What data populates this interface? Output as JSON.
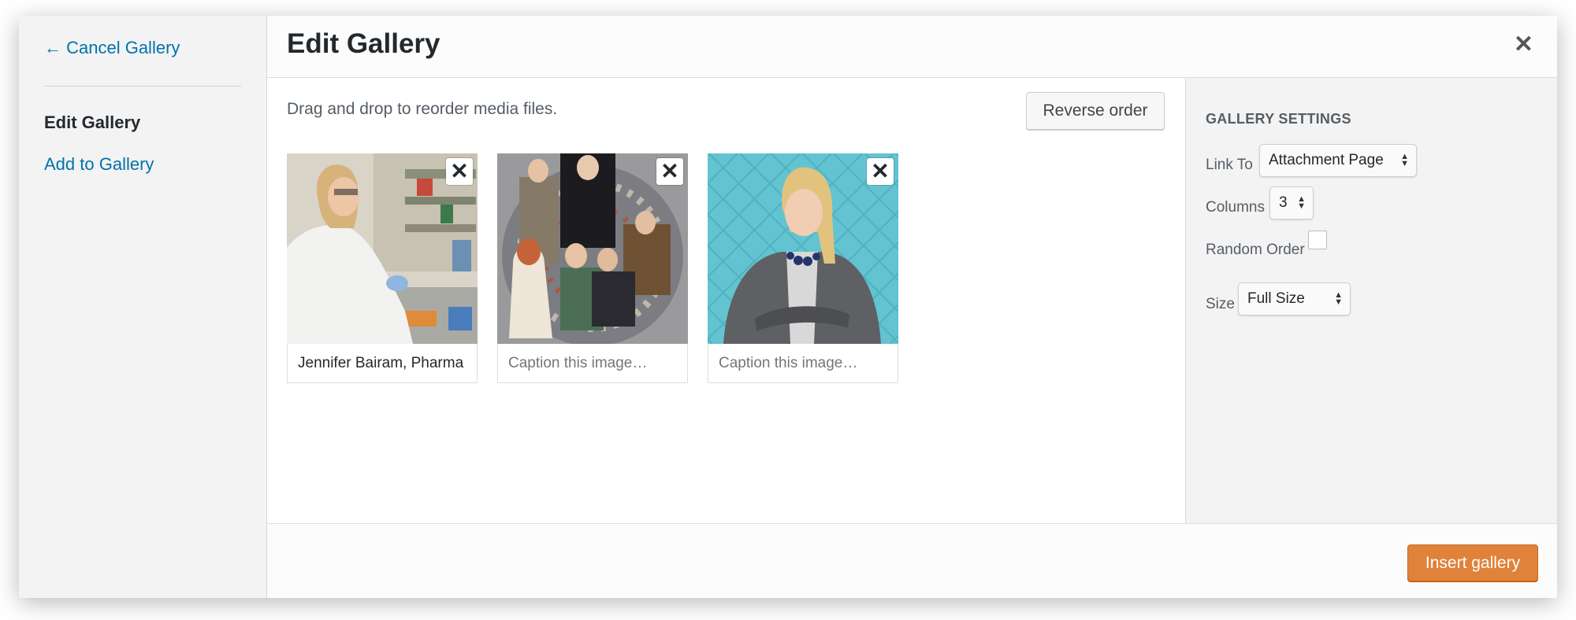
{
  "left_menu": {
    "cancel_label": "← Cancel Gallery",
    "current_label": "Edit Gallery",
    "add_label": "Add to Gallery"
  },
  "header": {
    "title": "Edit Gallery",
    "close_icon": "close-icon"
  },
  "main": {
    "hint": "Drag and drop to reorder media files.",
    "reverse_label": "Reverse order",
    "attachments": [
      {
        "caption_value": "Jennifer Bairam, Pharma",
        "caption_placeholder": "Caption this image…",
        "remove_icon": "close-icon"
      },
      {
        "caption_value": "",
        "caption_placeholder": "Caption this image…",
        "remove_icon": "close-icon"
      },
      {
        "caption_value": "",
        "caption_placeholder": "Caption this image…",
        "remove_icon": "close-icon"
      }
    ]
  },
  "settings": {
    "title": "Gallery Settings",
    "link_to_label": "Link To",
    "link_to_value": "Attachment Page",
    "columns_label": "Columns",
    "columns_value": "3",
    "random_order_label": "Random Order",
    "random_order_checked": false,
    "size_label": "Size",
    "size_value": "Full Size"
  },
  "toolbar": {
    "insert_label": "Insert gallery",
    "accent_color": "#e0823a"
  }
}
